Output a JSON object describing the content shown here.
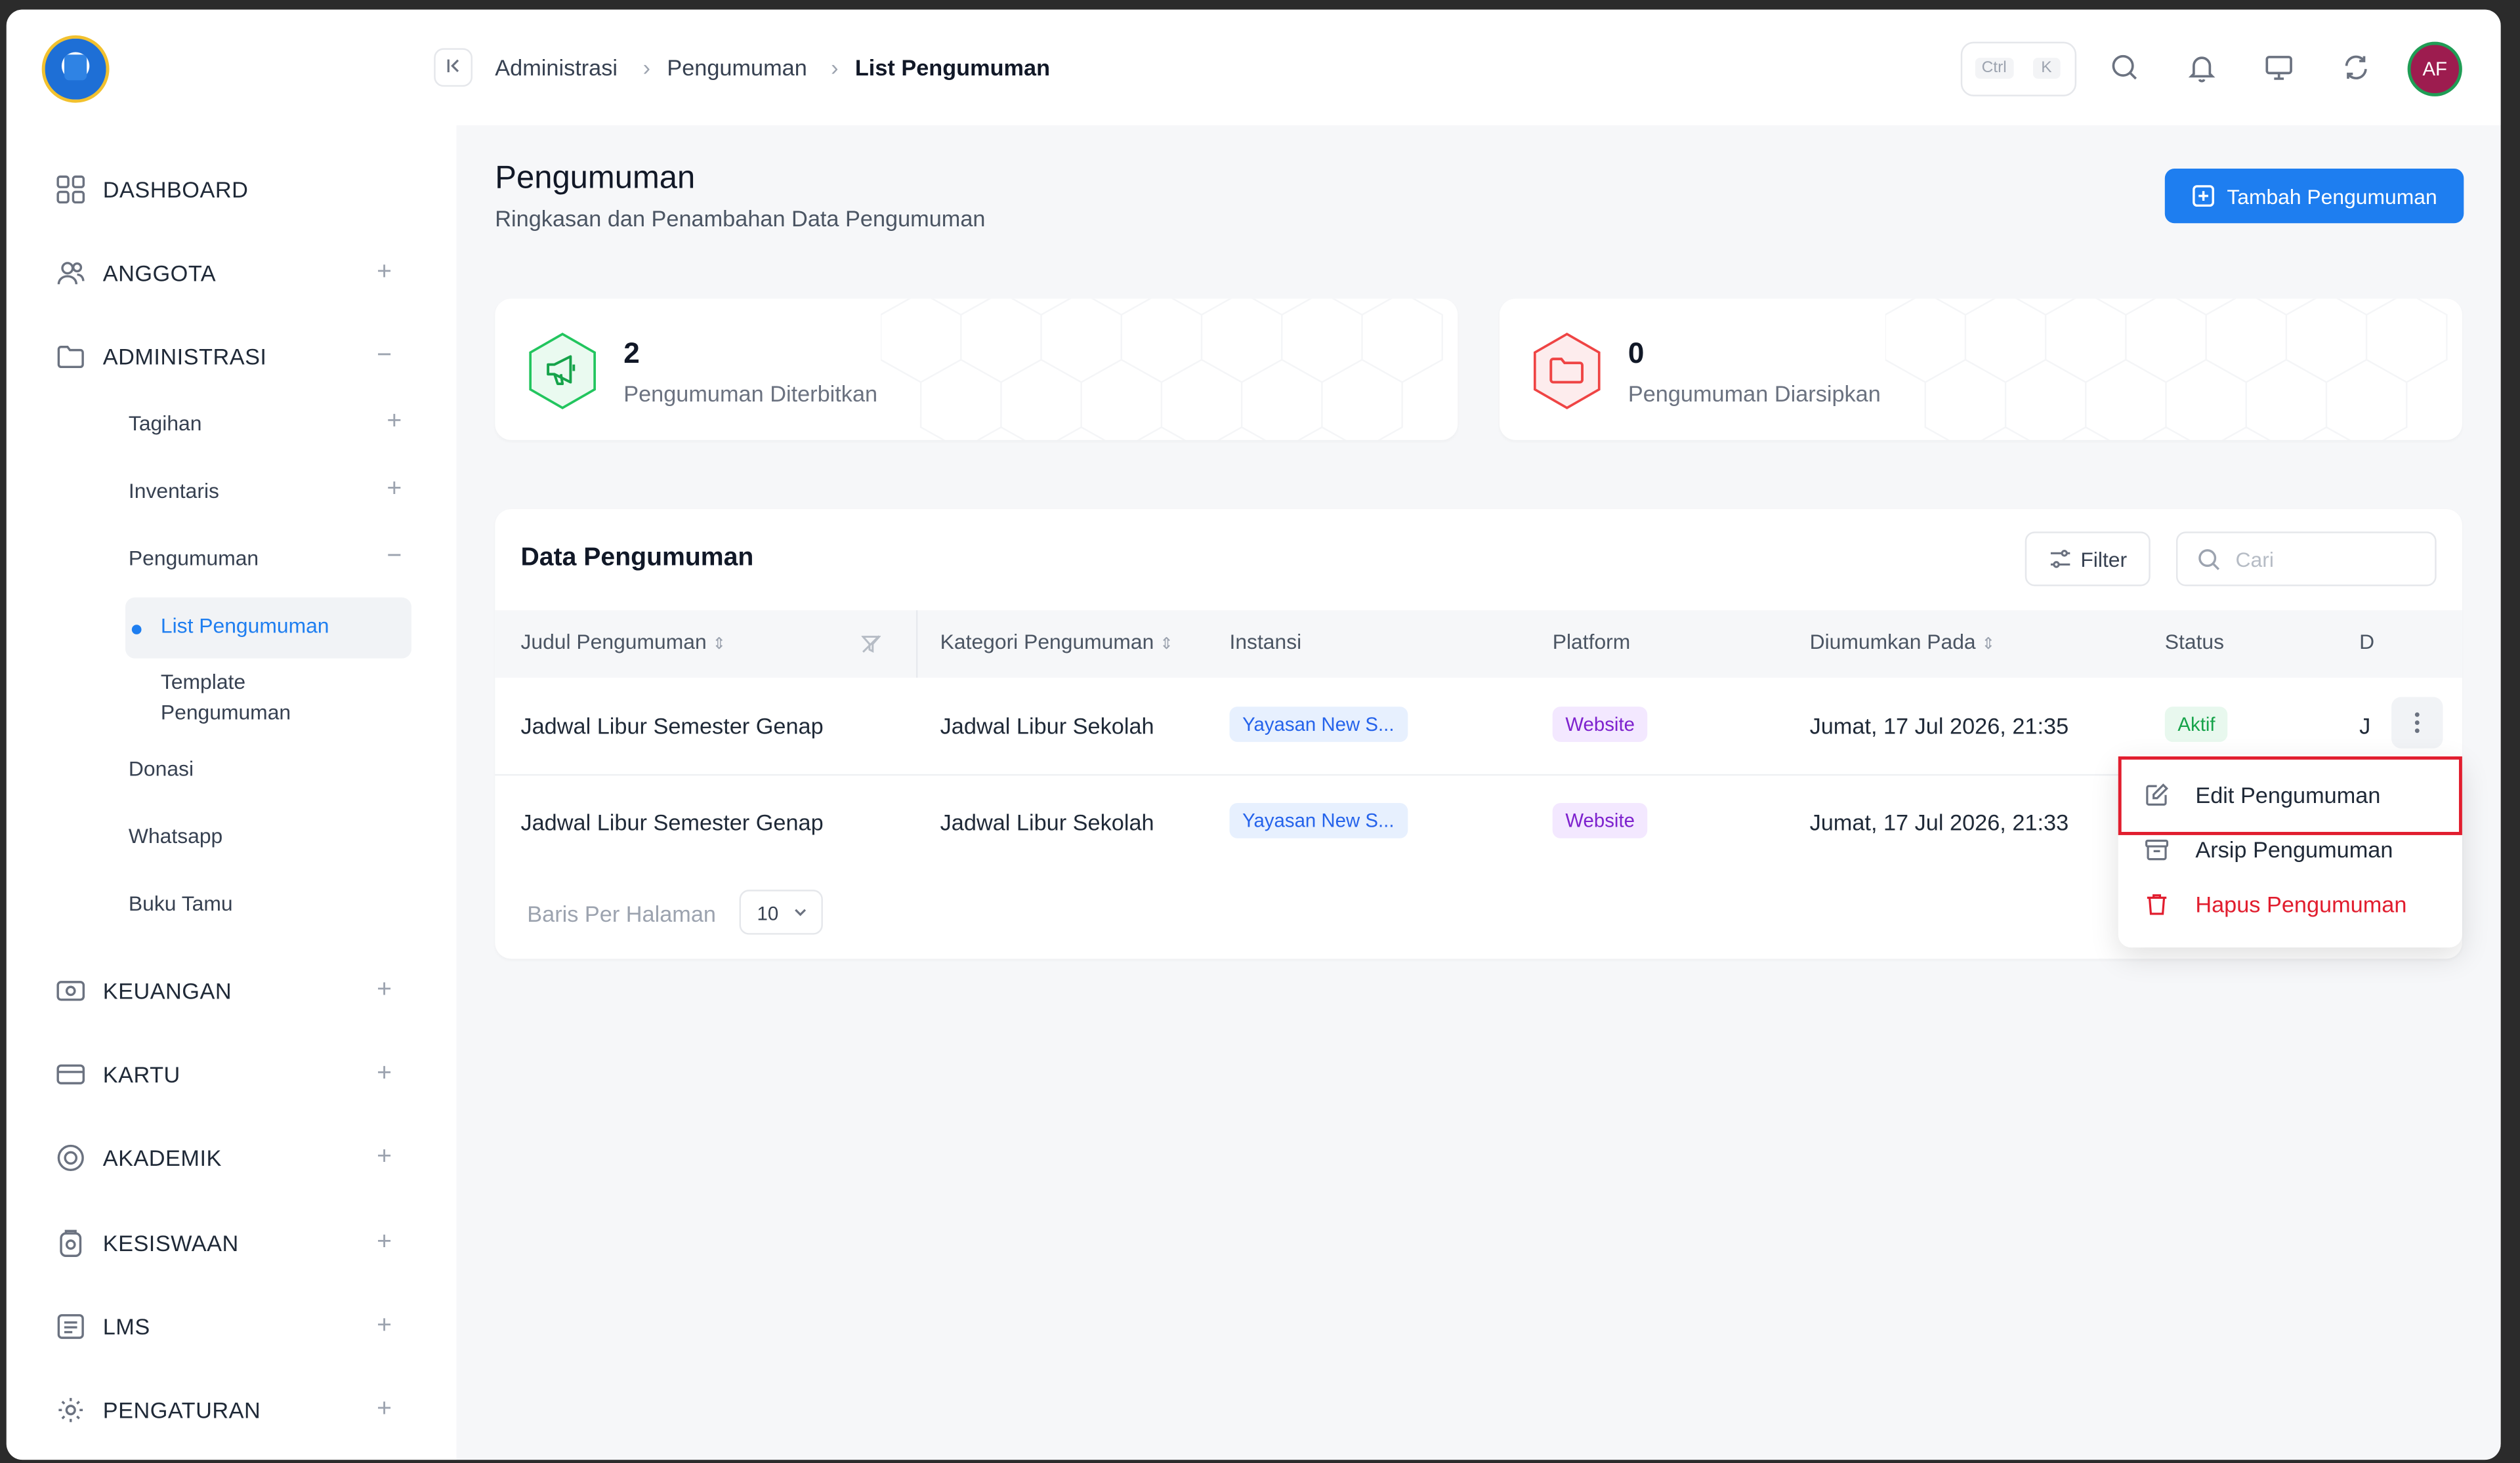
{
  "sidebar": {
    "items": [
      {
        "label": "DASHBOARD",
        "icon": "dashboard-grid-icon",
        "expander": ""
      },
      {
        "label": "ANGGOTA",
        "icon": "users-icon",
        "expander": "+"
      },
      {
        "label": "ADMINISTRASI",
        "icon": "folder-icon",
        "expander": "−"
      },
      {
        "label": "KEUANGAN",
        "icon": "money-icon",
        "expander": "+"
      },
      {
        "label": "KARTU",
        "icon": "card-icon",
        "expander": "+"
      },
      {
        "label": "AKADEMIK",
        "icon": "academic-icon",
        "expander": "+"
      },
      {
        "label": "KESISWAAN",
        "icon": "student-icon",
        "expander": "+"
      },
      {
        "label": "LMS",
        "icon": "lms-icon",
        "expander": "+"
      },
      {
        "label": "PENGATURAN",
        "icon": "gear-icon",
        "expander": "+"
      }
    ],
    "sub_items": [
      {
        "label": "Tagihan",
        "expander": "+"
      },
      {
        "label": "Inventaris",
        "expander": "+"
      },
      {
        "label": "Pengumuman",
        "expander": "−"
      },
      {
        "label": "Donasi",
        "expander": ""
      },
      {
        "label": "Whatsapp",
        "expander": ""
      },
      {
        "label": "Buku Tamu",
        "expander": ""
      }
    ],
    "sub_sub_items": [
      {
        "label": "List Pengumuman",
        "active": true
      },
      {
        "label": "Template Pengumuman",
        "active": false
      }
    ]
  },
  "header": {
    "breadcrumb": [
      "Administrasi",
      "Pengumuman",
      "List Pengumuman"
    ],
    "shortcut_keys": [
      "Ctrl",
      "K"
    ],
    "avatar_initials": "AF"
  },
  "page": {
    "title": "Pengumuman",
    "subtitle": "Ringkasan dan Penambahan Data Pengumuman",
    "add_button": "Tambah Pengumuman"
  },
  "stats": [
    {
      "value": "2",
      "label": "Pengumuman Diterbitkan",
      "color": "#22c55e"
    },
    {
      "value": "0",
      "label": "Pengumuman Diarsipkan",
      "color": "#ef4444"
    }
  ],
  "table": {
    "title": "Data Pengumuman",
    "filter_label": "Filter",
    "search_placeholder": "Cari",
    "columns": [
      "Judul Pengumuman",
      "Kategori Pengumuman",
      "Instansi",
      "Platform",
      "Diumumkan Pada",
      "Status",
      "D"
    ],
    "rows": [
      {
        "judul": "Jadwal Libur Semester Genap",
        "kategori": "Jadwal Libur Sekolah",
        "instansi": "Yayasan New S...",
        "platform": "Website",
        "tanggal": "Jumat, 17 Jul 2026, 21:35",
        "status": "Aktif",
        "d": "J"
      },
      {
        "judul": "Jadwal Libur Semester Genap",
        "kategori": "Jadwal Libur Sekolah",
        "instansi": "Yayasan New S...",
        "platform": "Website",
        "tanggal": "Jumat, 17 Jul 2026, 21:33",
        "status": "",
        "d": ""
      }
    ],
    "rows_per_page_label": "Baris Per Halaman",
    "rows_per_page_value": "10"
  },
  "row_menu": {
    "items": [
      {
        "label": "Edit Pengumuman",
        "icon": "edit-icon",
        "color": "#1f2937"
      },
      {
        "label": "Arsip Pengumuman",
        "icon": "archive-icon",
        "color": "#1f2937"
      },
      {
        "label": "Hapus Pengumuman",
        "icon": "trash-icon",
        "color": "#e11d2e"
      }
    ]
  },
  "colors": {
    "accent": "#1e7ef0",
    "danger": "#e11d2e",
    "success": "#16a34a"
  }
}
